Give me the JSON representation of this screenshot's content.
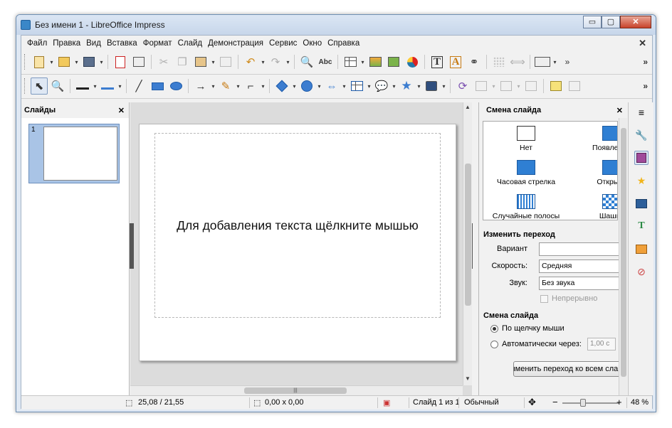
{
  "window": {
    "title": "Без имени 1 - LibreOffice Impress",
    "controls": {
      "minimize": "▭",
      "maximize": "▢",
      "close": "✕"
    }
  },
  "menu": {
    "items": [
      {
        "label": "Файл"
      },
      {
        "label": "Правка"
      },
      {
        "label": "Вид"
      },
      {
        "label": "Вставка"
      },
      {
        "label": "Формат"
      },
      {
        "label": "Слайд"
      },
      {
        "label": "Демонстрация"
      },
      {
        "label": "Сервис"
      },
      {
        "label": "Окно"
      },
      {
        "label": "Справка"
      }
    ],
    "close": "✕"
  },
  "toolbar_standard": {
    "overflow": "»",
    "icons": [
      "new-icon",
      "open-icon",
      "save-icon",
      "export-pdf-icon",
      "print-icon",
      "cut-icon",
      "copy-icon",
      "paste-icon",
      "clone-formatting-icon",
      "undo-icon",
      "redo-icon",
      "find-icon",
      "spellcheck-icon",
      "table-icon",
      "image-icon",
      "media-icon",
      "chart-icon",
      "text-box-icon",
      "fontwork-icon",
      "hyperlink-icon",
      "grid-icon",
      "helplines-icon",
      "display-views-icon"
    ],
    "glyphs": {
      "cut": "✂",
      "copy": "❐",
      "undo": "↶",
      "redo": "↷",
      "find": "🔍",
      "spell": "Abc",
      "T": "T",
      "A": "A"
    }
  },
  "toolbar_drawing": {
    "overflow": "»",
    "glyphs": {
      "select": "⬉",
      "zoom": "🔍",
      "line": "╱",
      "arrow": "→",
      "pencil": "✎",
      "connector": "⌐",
      "double_arrow": "⇔",
      "callout": "💬",
      "star": "★",
      "rotate": "⟳"
    }
  },
  "slides_panel": {
    "title": "Слайды",
    "close": "✕",
    "slides": [
      {
        "number": "1"
      }
    ]
  },
  "editor": {
    "placeholder": "Для добавления текста щёлкните мышью",
    "scroll_up": "▲",
    "scroll_down": "▼",
    "hscroll_grip": "|||"
  },
  "task_pane": {
    "title": "Смена слайда",
    "close": "✕",
    "transitions": [
      {
        "label": "Нет",
        "icon": "none-transition-icon"
      },
      {
        "label": "Появление",
        "icon": "wipe-up-icon"
      },
      {
        "label": "Часовая стрелка",
        "icon": "clockwise-icon"
      },
      {
        "label": "Открыть",
        "icon": "uncover-icon"
      },
      {
        "label": "Случайные полосы",
        "icon": "random-bars-icon"
      },
      {
        "label": "Шашки",
        "icon": "checkerboard-icon"
      }
    ],
    "modify_section": "Изменить переход",
    "variant_label": "Вариант",
    "variant_value": "",
    "speed_label": "Скорость:",
    "speed_value": "Средняя",
    "sound_label": "Звук:",
    "sound_value": "Без звука",
    "loop_label": "Непрерывно",
    "advance_section": "Смена слайда",
    "on_click_label": "По щелчку мыши",
    "auto_label": "Автоматически через:",
    "auto_value": "1,00 с",
    "apply_button": "Применить переход ко всем слайдам"
  },
  "sidebar": {
    "menu_glyph": "≡",
    "icons": [
      "properties-icon",
      "slide-transition-icon",
      "animation-icon",
      "master-slides-icon",
      "styles-icon",
      "gallery-icon",
      "navigator-icon"
    ]
  },
  "status": {
    "position": "25,08 / 21,55",
    "size": "0,00 x 0,00",
    "slide": "Слайд 1 из 1",
    "layout": "Обычный",
    "zoom": "48 %",
    "zoom_minus": "−",
    "zoom_plus": "+"
  }
}
